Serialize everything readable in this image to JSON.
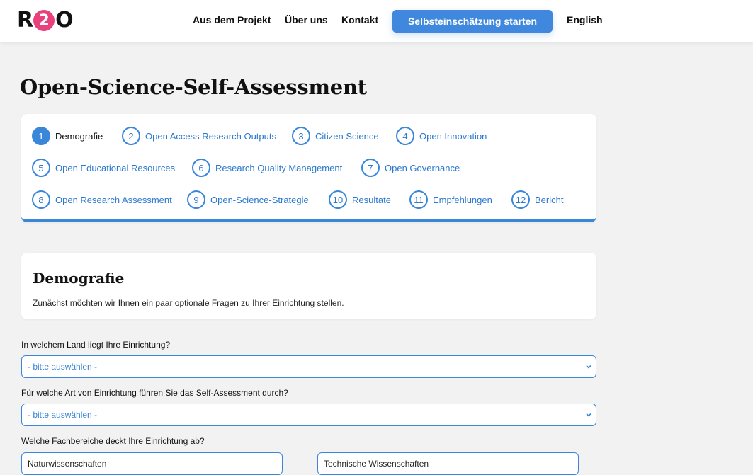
{
  "header": {
    "logo": {
      "letter_left": "R",
      "letter_circle": "2",
      "letter_right": "O"
    },
    "nav": [
      "Aus dem Projekt",
      "Über uns",
      "Kontakt"
    ],
    "cta": "Selbsteinschätzung starten",
    "language": "English"
  },
  "page": {
    "title": "Open-Science-Self-Assessment"
  },
  "stepper": {
    "current_step": 1,
    "steps": [
      {
        "num": "1",
        "label": "Demografie"
      },
      {
        "num": "2",
        "label": "Open Access Research Outputs"
      },
      {
        "num": "3",
        "label": "Citizen Science"
      },
      {
        "num": "4",
        "label": "Open Innovation"
      },
      {
        "num": "5",
        "label": "Open Educational Resources"
      },
      {
        "num": "6",
        "label": "Research Quality Management"
      },
      {
        "num": "7",
        "label": "Open Governance"
      },
      {
        "num": "8",
        "label": "Open Research Assessment"
      },
      {
        "num": "9",
        "label": "Open-Science-Strategie"
      },
      {
        "num": "10",
        "label": "Resultate"
      },
      {
        "num": "11",
        "label": "Empfehlungen"
      },
      {
        "num": "12",
        "label": "Bericht"
      }
    ]
  },
  "section": {
    "title": "Demografie",
    "intro": "Zunächst möchten wir Ihnen ein paar optionale Fragen zu Ihrer Einrichtung stellen."
  },
  "form": {
    "q1": {
      "label": "In welchem Land liegt Ihre Einrichtung?",
      "value": "- bitte auswählen -"
    },
    "q2": {
      "label": "Für welche Art von Einrichtung führen Sie das Self-Assessment durch?",
      "value": "- bitte auswählen -"
    },
    "q3": {
      "label": "Welche Fachbereiche deckt Ihre Einrichtung ab?",
      "options": [
        "Naturwissenschaften",
        "Technische Wissenschaften"
      ]
    }
  },
  "colors": {
    "accent": "#3a86d8",
    "logo_pink": "#e8417b",
    "background": "#f2f2f2"
  }
}
